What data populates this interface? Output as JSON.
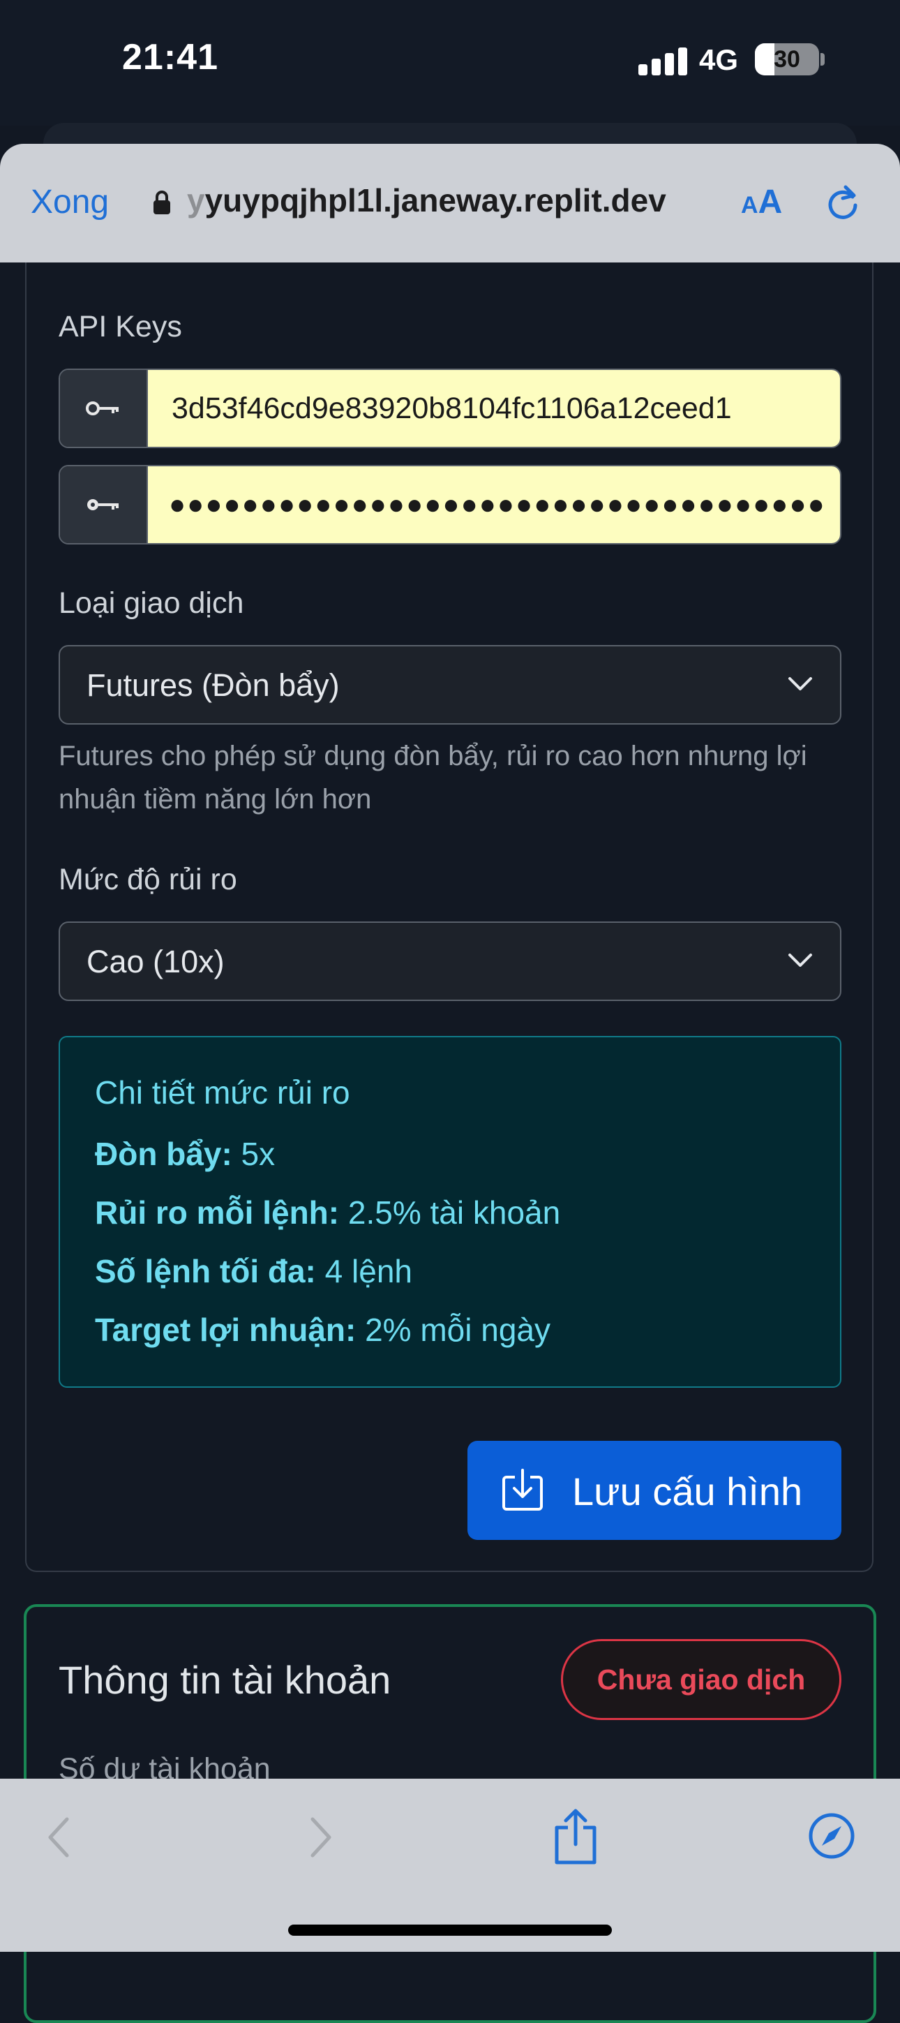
{
  "status_bar": {
    "time": "21:41",
    "network": "4G",
    "battery": "30"
  },
  "browser": {
    "done_label": "Xong",
    "url_prefix": "y",
    "url": "yuypqjhpl1l.janeway.replit.dev",
    "aa_small": "A",
    "aa_big": "A"
  },
  "api_keys": {
    "label": "API Keys",
    "api_key_value": "3d53f46cd9e83920b8104fc1106a12ceed1",
    "secret_mask": "●●●●●●●●●●●●●●●●●●●●●●●●●●●●●●●●●●●●"
  },
  "trade_type": {
    "label": "Loại giao dịch",
    "selected": "Futures (Đòn bẩy)",
    "help": "Futures cho phép sử dụng đòn bẩy, rủi ro cao hơn nhưng lợi nhuận tiềm năng lớn hơn"
  },
  "risk_level": {
    "label": "Mức độ rủi ro",
    "selected": "Cao (10x)"
  },
  "risk_details": {
    "title": "Chi tiết mức rủi ro",
    "rows": [
      {
        "key": "Đòn bẩy:",
        "value": " 5x"
      },
      {
        "key": "Rủi ro mỗi lệnh:",
        "value": " 2.5% tài khoản"
      },
      {
        "key": "Số lệnh tối đa:",
        "value": " 4 lệnh"
      },
      {
        "key": "Target lợi nhuận:",
        "value": " 2% mỗi ngày"
      }
    ]
  },
  "save_button": {
    "label": "Lưu cấu hình"
  },
  "account": {
    "title": "Thông tin tài khoản",
    "status": "Chưa giao dịch",
    "balance_label": "Số dư tài khoản"
  },
  "colors": {
    "page_bg": "#121823",
    "primary": "#0b5ed7",
    "success_border": "#198754",
    "danger": "#dc3545",
    "info_text": "#6fdcf0",
    "input_bg": "#fdfdc0",
    "safari_blue": "#1f6fd6"
  },
  "icons": [
    "lock-icon",
    "reload-icon",
    "key-icon",
    "chevron-down-icon",
    "download-icon",
    "back-icon",
    "forward-icon",
    "share-icon",
    "compass-icon"
  ]
}
